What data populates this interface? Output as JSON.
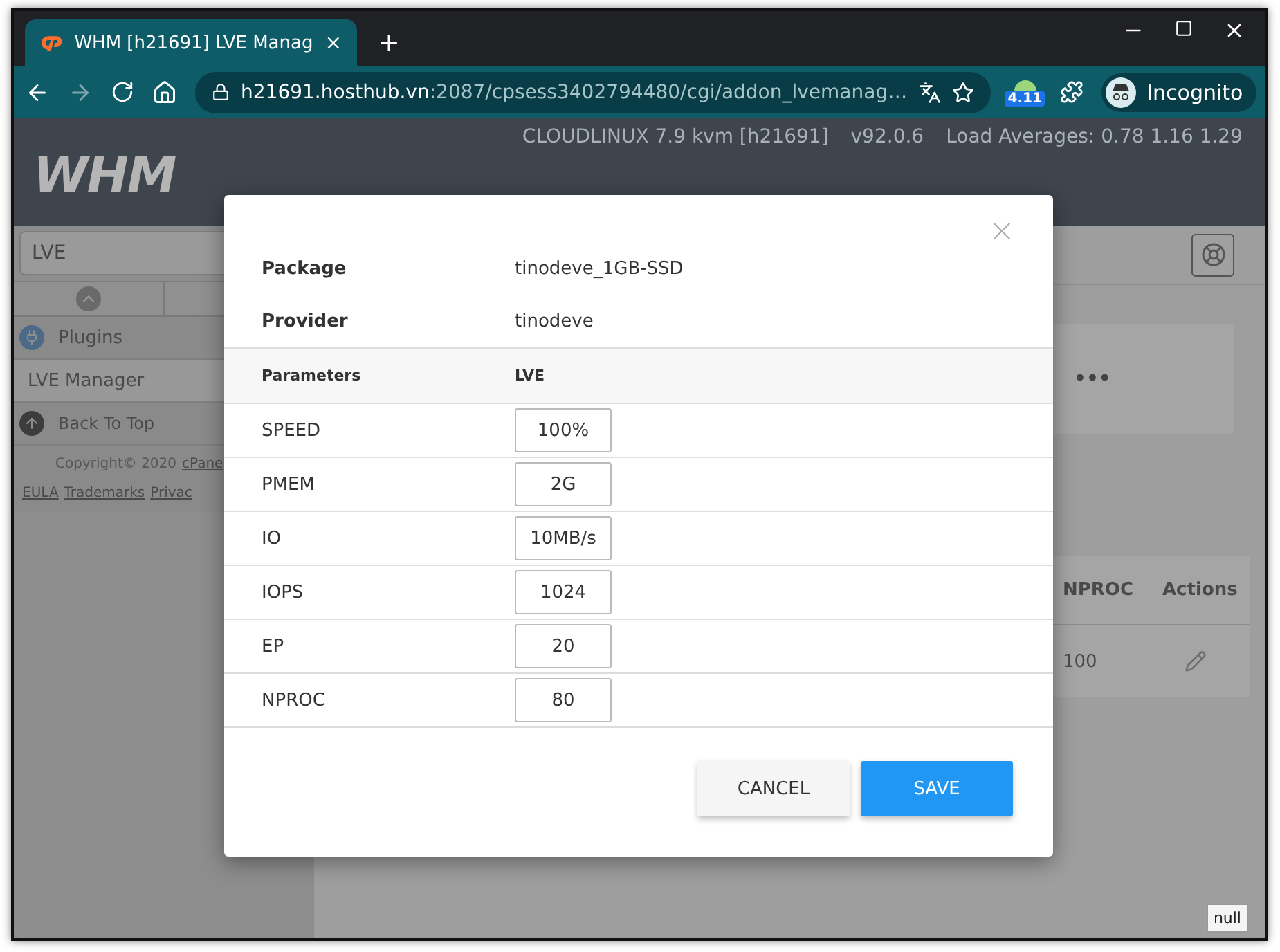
{
  "browser": {
    "tab_title": "WHM [h21691] LVE Manag",
    "url_host": "h21691.hosthub.vn",
    "url_rest": ":2087/cpsess3402794480/cgi/addon_lvemanag…",
    "extension_badge": "4.11",
    "profile": "Incognito"
  },
  "header": {
    "server_info": [
      "CLOUDLINUX 7.9 kvm [h21691]",
      "v92.0.6",
      "Load Averages: 0.78 1.16 1.29"
    ],
    "logo": "WHM"
  },
  "sidebar": {
    "search_value": "LVE",
    "items": [
      {
        "kind": "category",
        "label": "Plugins",
        "selected": false
      },
      {
        "kind": "link",
        "label": "LVE Manager",
        "selected": true
      },
      {
        "kind": "back",
        "label": "Back To Top",
        "selected": false
      }
    ],
    "copyright": "Copyright© 2020 ",
    "copyright_link": "cPane",
    "footer_links": [
      "EULA",
      "Trademarks",
      "Privac"
    ]
  },
  "content": {
    "card_menu": "•••",
    "table": {
      "columns": [
        "NPROC",
        "Actions"
      ],
      "rows": [
        [
          "100"
        ]
      ]
    }
  },
  "badge": "null",
  "modal": {
    "info": [
      {
        "label": "Package",
        "value": "tinodeve_1GB-SSD"
      },
      {
        "label": "Provider",
        "value": "tinodeve"
      }
    ],
    "columns": [
      "Parameters",
      "LVE"
    ],
    "params": [
      {
        "name": "SPEED",
        "value": "100%"
      },
      {
        "name": "PMEM",
        "value": "2G"
      },
      {
        "name": "IO",
        "value": "10MB/s"
      },
      {
        "name": "IOPS",
        "value": "1024"
      },
      {
        "name": "EP",
        "value": "20"
      },
      {
        "name": "NPROC",
        "value": "80"
      }
    ],
    "buttons": [
      {
        "kind": "secondary",
        "label": "CANCEL"
      },
      {
        "kind": "primary",
        "label": "SAVE"
      }
    ]
  }
}
